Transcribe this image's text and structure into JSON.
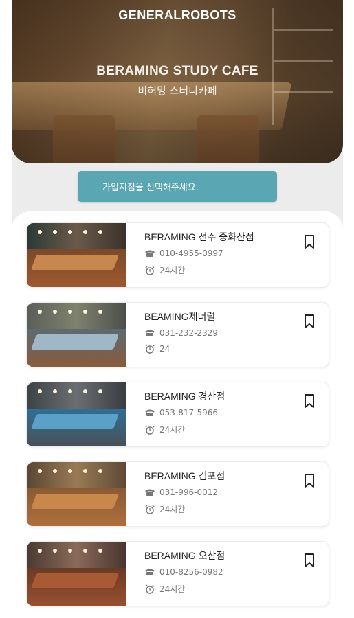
{
  "header": {
    "brand": "GENERALROBOTS",
    "title": "BERAMING STUDY CAFE",
    "subtitle": "비허밍 스터디카페"
  },
  "select": {
    "label": "가입지점을 선택해주세요."
  },
  "colors": {
    "accent": "#5aa6b3",
    "icon": "#777777"
  },
  "stores": [
    {
      "name": "BERAMING 전주 중화산점",
      "phone": "010-4955-0997",
      "hours": "24시간"
    },
    {
      "name": "BEAMING제너럴",
      "phone": "031-232-2329",
      "hours": "24"
    },
    {
      "name": "BERAMING 경산점",
      "phone": "053-817-5966",
      "hours": "24시간"
    },
    {
      "name": "BERAMING 김포점",
      "phone": "031-996-0012",
      "hours": "24시간"
    },
    {
      "name": "BERAMING 오산점",
      "phone": "010-8256-0982",
      "hours": "24시간"
    }
  ],
  "icons": {
    "phone": "telephone-icon",
    "clock": "alarm-clock-icon",
    "bookmark": "bookmark-icon"
  }
}
